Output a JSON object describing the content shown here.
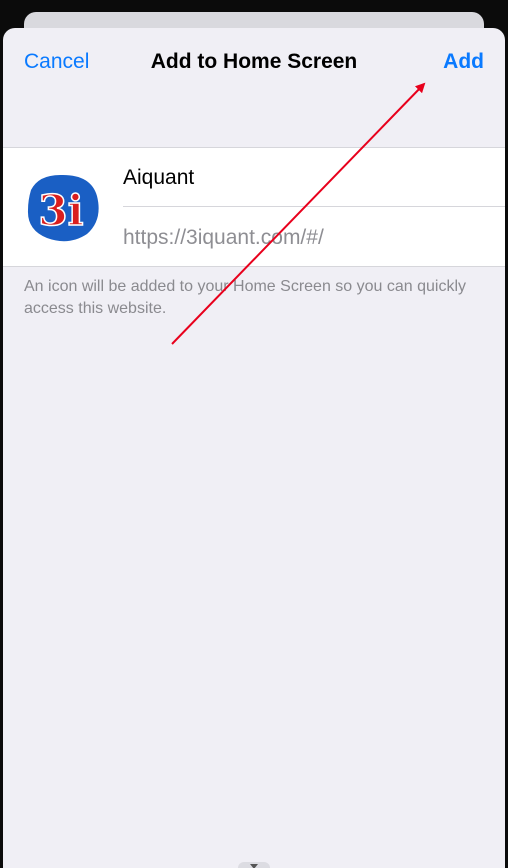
{
  "nav": {
    "cancel_label": "Cancel",
    "title": "Add to Home Screen",
    "add_label": "Add"
  },
  "bookmark": {
    "icon_text": "3i",
    "name_value": "Aiquant",
    "url_value": "https://3iquant.com/#/"
  },
  "footnote": "An icon will be added to your Home Screen so you can quickly access this website.",
  "colors": {
    "accent": "#0a7aff",
    "annotation_arrow": "#e8001c",
    "icon_blue": "#1a5fc4",
    "icon_red": "#d91e1e"
  }
}
